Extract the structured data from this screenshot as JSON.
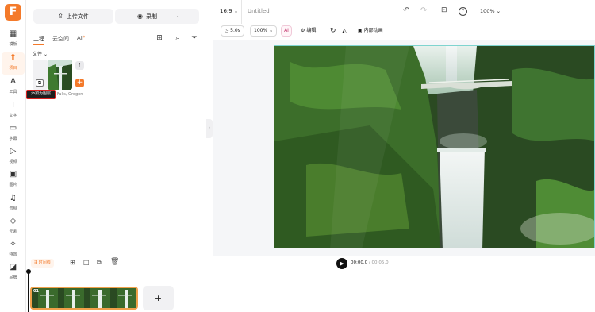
{
  "app": {
    "logo_letter": "F",
    "accent": "#f47a2a",
    "title": "Untitled"
  },
  "rail": [
    {
      "id": "templates",
      "label": "模板",
      "icon": "grid-icon",
      "glyph": "▦"
    },
    {
      "id": "project",
      "label": "项目",
      "icon": "folder-upload-icon",
      "glyph": "⬆",
      "active": true
    },
    {
      "id": "ai-tools",
      "label": "工具",
      "icon": "ai-tools-icon",
      "glyph": "A"
    },
    {
      "id": "text",
      "label": "文字",
      "icon": "text-icon",
      "glyph": "T"
    },
    {
      "id": "subtitles",
      "label": "字幕",
      "icon": "subtitle-icon",
      "glyph": "▭"
    },
    {
      "id": "video",
      "label": "视频",
      "icon": "video-icon",
      "glyph": "▷"
    },
    {
      "id": "images",
      "label": "图片",
      "icon": "image-icon",
      "glyph": "▣"
    },
    {
      "id": "audio",
      "label": "音频",
      "icon": "music-icon",
      "glyph": "♫"
    },
    {
      "id": "elements",
      "label": "元素",
      "icon": "shapes-icon",
      "glyph": "◇"
    },
    {
      "id": "effects",
      "label": "特效",
      "icon": "sparkle-icon",
      "glyph": "✧"
    },
    {
      "id": "brand",
      "label": "品牌",
      "icon": "brand-icon",
      "glyph": "◪"
    }
  ],
  "panel": {
    "upload_label": "上传文件",
    "record_label": "录制",
    "tabs": [
      {
        "label": "工程",
        "active": true
      },
      {
        "label": "云空间",
        "active": false
      },
      {
        "label": "AI",
        "active": false
      }
    ],
    "section_label": "文件",
    "media_caption": "Falls, Oregon",
    "tooltip": "添加为图层"
  },
  "header": {
    "ratio": "16:9",
    "zoom": "100%"
  },
  "toolbar": {
    "duration": "5.0s",
    "scale": "100%",
    "edit_label": "编辑",
    "animation_label": "内部动画"
  },
  "timeline": {
    "badge": "时间线",
    "current_time": "00:00.0",
    "total_time": "00:05.0",
    "clip_index": "01",
    "add_label": "+"
  }
}
